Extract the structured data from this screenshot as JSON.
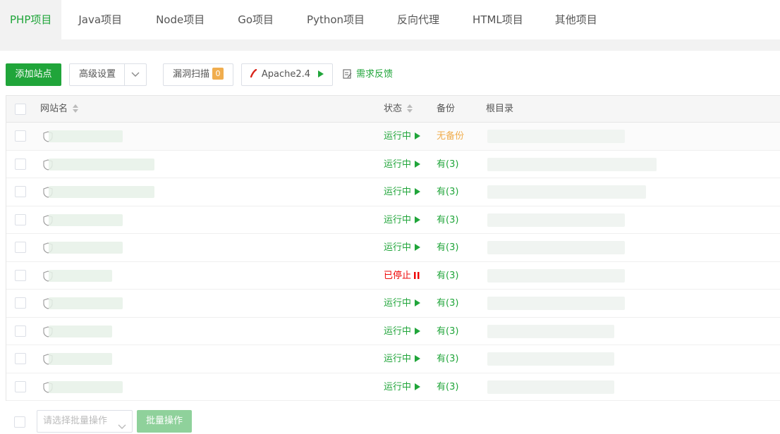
{
  "tabs": [
    {
      "label": "PHP项目",
      "active": true
    },
    {
      "label": "Java项目"
    },
    {
      "label": "Node项目"
    },
    {
      "label": "Go项目"
    },
    {
      "label": "Python项目"
    },
    {
      "label": "反向代理"
    },
    {
      "label": "HTML项目"
    },
    {
      "label": "其他项目"
    }
  ],
  "toolbar": {
    "add_site": "添加站点",
    "advanced": "高级设置",
    "vuln_scan": "漏洞扫描",
    "vuln_count": "0",
    "apache": "Apache2.4",
    "feedback": "需求反馈"
  },
  "table": {
    "headers": {
      "name": "网站名",
      "status": "状态",
      "backup": "备份",
      "root": "根目录"
    },
    "rows": [
      {
        "status": "运行中",
        "state": "running",
        "backup": "无备份",
        "has_backup": false
      },
      {
        "status": "运行中",
        "state": "running",
        "backup": "有(3)",
        "has_backup": true
      },
      {
        "status": "运行中",
        "state": "running",
        "backup": "有(3)",
        "has_backup": true
      },
      {
        "status": "运行中",
        "state": "running",
        "backup": "有(3)",
        "has_backup": true
      },
      {
        "status": "运行中",
        "state": "running",
        "backup": "有(3)",
        "has_backup": true
      },
      {
        "status": "已停止",
        "state": "stopped",
        "backup": "有(3)",
        "has_backup": true
      },
      {
        "status": "运行中",
        "state": "running",
        "backup": "有(3)",
        "has_backup": true
      },
      {
        "status": "运行中",
        "state": "running",
        "backup": "有(3)",
        "has_backup": true
      },
      {
        "status": "运行中",
        "state": "running",
        "backup": "有(3)",
        "has_backup": true
      },
      {
        "status": "运行中",
        "state": "running",
        "backup": "有(3)",
        "has_backup": true
      }
    ]
  },
  "footer": {
    "batch_placeholder": "请选择批量操作",
    "batch_button": "批量操作"
  },
  "colors": {
    "accent": "#20a53a",
    "stopped": "#ef0808",
    "warning": "#f0ad4e"
  }
}
